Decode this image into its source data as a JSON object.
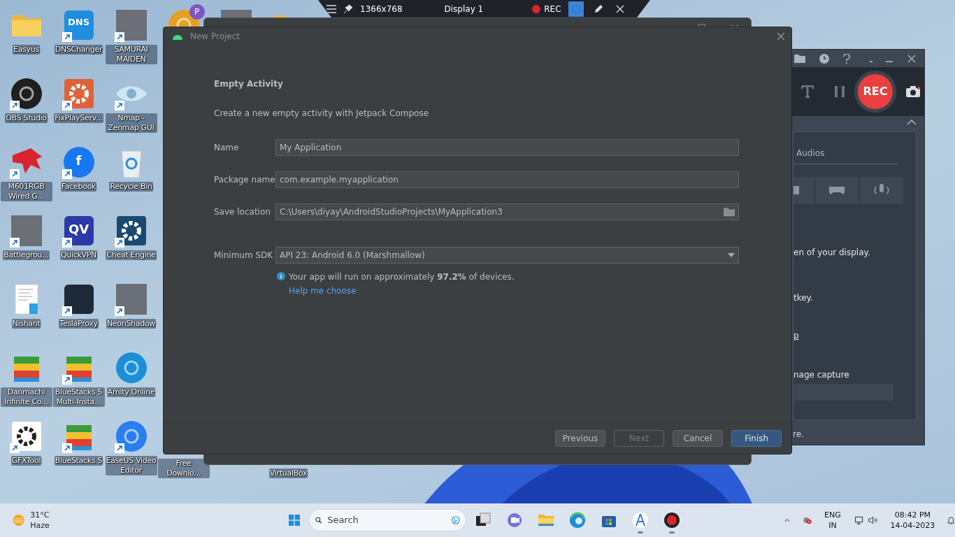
{
  "desktop_columns": [
    [
      {
        "label": "Easyus",
        "kind": "folder",
        "shortcut": false
      },
      {
        "label": "OBS Studio",
        "kind": "circle",
        "color": "#1f1f1f",
        "shortcut": true
      },
      {
        "label": "M601RGB Wired G...",
        "kind": "emblem",
        "color": "#d9232d",
        "shortcut": true
      },
      {
        "label": "Battlegrou...",
        "kind": "photo",
        "shortcut": true
      },
      {
        "label": "Nishant",
        "kind": "document",
        "shortcut": false
      },
      {
        "label": "Danmachi Infinite Co...",
        "kind": "stack",
        "shortcut": false
      },
      {
        "label": "GFXTool",
        "kind": "gear",
        "color": "#ffffff",
        "shortcut": true
      }
    ],
    [
      {
        "label": "DNSChanger",
        "kind": "tile",
        "color": "#1e8fe0",
        "glyph": "DNS",
        "shortcut": true
      },
      {
        "label": "FixPlayServ...",
        "kind": "gear",
        "color": "#e0623a",
        "shortcut": true
      },
      {
        "label": "Facebook",
        "kind": "circle",
        "color": "#1877f2",
        "glyph": "f",
        "shortcut": true
      },
      {
        "label": "QuickVPN",
        "kind": "tile",
        "color": "#2b3aa8",
        "glyph": "QV",
        "shortcut": true
      },
      {
        "label": "TeslaProxy",
        "kind": "tile",
        "color": "#1f2a38",
        "shortcut": true
      },
      {
        "label": "BlueStacks 5 Multi-Insta...",
        "kind": "stack",
        "shortcut": true
      },
      {
        "label": "BlueStacks 5",
        "kind": "stack",
        "shortcut": true
      }
    ],
    [
      {
        "label": "SAMURAI MAIDEN",
        "kind": "photo",
        "shortcut": true
      },
      {
        "label": "Nmap - Zenmap GUI",
        "kind": "eye",
        "shortcut": true
      },
      {
        "label": "Recycle Bin",
        "kind": "recycle",
        "shortcut": false
      },
      {
        "label": "Cheat Engine",
        "kind": "gear",
        "color": "#1a4a70",
        "shortcut": true
      },
      {
        "label": "NeonShadow",
        "kind": "photo",
        "shortcut": true
      },
      {
        "label": "Amity Online",
        "kind": "circle",
        "color": "#1a8fd8",
        "shortcut": false
      },
      {
        "label": "EaseUS Video Editor",
        "kind": "circle",
        "color": "#2a7ef0",
        "shortcut": true
      }
    ],
    [
      {
        "kind": "circle",
        "color": "#e8a020",
        "badge": "P"
      },
      null,
      null,
      null,
      null,
      null,
      {
        "label": "Free Downlo...",
        "kind": "covered"
      }
    ],
    [
      {
        "kind": "photo"
      },
      null,
      null,
      null,
      null,
      null,
      null
    ],
    [
      {
        "kind": "folder"
      },
      null,
      null,
      null,
      null,
      null,
      {
        "label": "VirtualBox",
        "kind": "covered"
      }
    ]
  ],
  "capture_bar": {
    "resolution": "1366x768",
    "display": "Display 1",
    "rec": "REC"
  },
  "dialog": {
    "title": "New Project",
    "heading": "Empty Activity",
    "description": "Create a new empty activity with Jetpack Compose",
    "fields": [
      {
        "label": "Name",
        "value": "My Application",
        "kind": "text"
      },
      {
        "label": "Package name",
        "value": "com.example.myapplication",
        "kind": "text"
      },
      {
        "label": "Save location",
        "value": "C:\\Users\\diyay\\AndroidStudioProjects\\MyApplication3",
        "kind": "folder"
      },
      {
        "label": "Minimum SDK",
        "value": "API 23: Android 6.0 (Marshmallow)",
        "kind": "dropdown"
      }
    ],
    "info": "Your app will run on approximately **97.2%** of devices.",
    "help_link": "Help me choose",
    "buttons": [
      {
        "label": "Previous",
        "disabled": false,
        "primary": false
      },
      {
        "label": "Next",
        "disabled": true,
        "primary": false
      },
      {
        "label": "Cancel",
        "disabled": false,
        "primary": false
      },
      {
        "label": "Finish",
        "disabled": false,
        "primary": true
      }
    ]
  },
  "recorder": {
    "rec_button": "REC",
    "tab": "Audios",
    "texts": [
      {
        "text": "en of your display.",
        "kind": "plain"
      },
      {
        "text": "tkey.",
        "kind": "plain"
      },
      {
        "text": "p",
        "kind": "link"
      },
      {
        "text": "nage capture",
        "kind": "plain"
      }
    ],
    "footer": "re."
  },
  "taskbar": {
    "temperature": "31°C",
    "weather": "Haze",
    "search_placeholder": "Search",
    "apps": [
      {
        "kind": "taskview",
        "running": false
      },
      {
        "kind": "meet",
        "running": false
      },
      {
        "kind": "explorer",
        "running": false
      },
      {
        "kind": "edge",
        "running": false
      },
      {
        "kind": "store",
        "running": false
      },
      {
        "kind": "studio",
        "running": true
      },
      {
        "kind": "recorder",
        "running": true
      }
    ],
    "language": "ENG",
    "region": "IN",
    "time": "08:42 PM",
    "date": "14-04-2023"
  }
}
